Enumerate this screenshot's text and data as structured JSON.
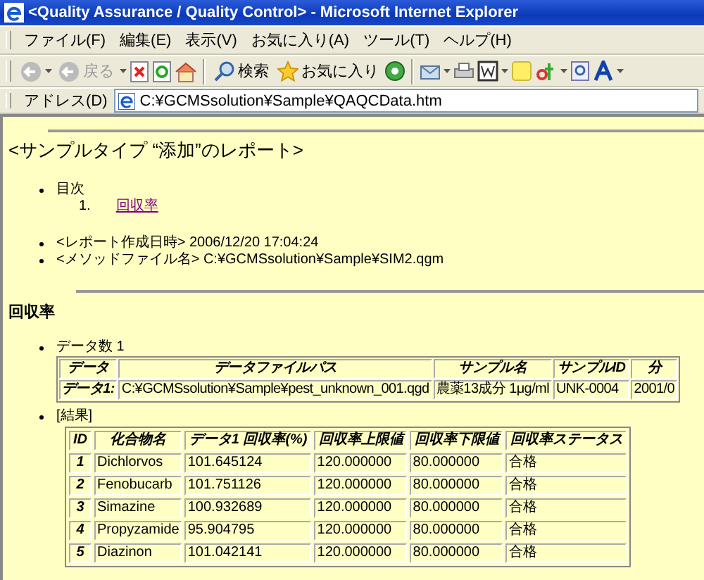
{
  "window": {
    "title": "<Quality Assurance / Quality Control> - Microsoft Internet Explorer"
  },
  "menu": [
    "ファイル(F)",
    "編集(E)",
    "表示(V)",
    "お気に入り(A)",
    "ツール(T)",
    "ヘルプ(H)"
  ],
  "toolbar": {
    "back": "戻る",
    "search": "検索",
    "favorites": "お気に入り"
  },
  "address": {
    "label": "アドレス(D)",
    "value": "C:¥GCMSsolution¥Sample¥QAQCData.htm"
  },
  "report": {
    "heading": "<サンプルタイプ “添加”のレポート>",
    "toc_label": "目次",
    "toc_items": [
      {
        "number": "1.",
        "label": "回収率"
      }
    ],
    "info": [
      "<レポート作成日時> 2006/12/20 17:04:24",
      "<メソッドファイル名> C:¥GCMSsolution¥Sample¥SIM2.qgm"
    ]
  },
  "section": {
    "title": "回収率",
    "data_count": "データ数 1",
    "data_table": {
      "columns": [
        "データ",
        "データファイルパス",
        "サンプル名",
        "サンプルID",
        "分"
      ],
      "rows": [
        [
          "データ1:",
          "C:¥GCMSsolution¥Sample¥pest_unknown_001.qgd",
          "農薬13成分 1μg/ml",
          "UNK-0004",
          "2001/0"
        ]
      ]
    },
    "results_label": "[結果]",
    "results_table": {
      "columns": [
        "ID",
        "化合物名",
        "データ1 回収率(%)",
        "回収率上限値",
        "回収率下限値",
        "回収率ステータス"
      ],
      "rows": [
        [
          "1",
          "Dichlorvos",
          "101.645124",
          "120.000000",
          "80.000000",
          "合格"
        ],
        [
          "2",
          "Fenobucarb",
          "101.751126",
          "120.000000",
          "80.000000",
          "合格"
        ],
        [
          "3",
          "Simazine",
          "100.932689",
          "120.000000",
          "80.000000",
          "合格"
        ],
        [
          "4",
          "Propyzamide",
          "95.904795",
          "120.000000",
          "80.000000",
          "合格"
        ],
        [
          "5",
          "Diazinon",
          "101.042141",
          "120.000000",
          "80.000000",
          "合格"
        ]
      ]
    }
  }
}
